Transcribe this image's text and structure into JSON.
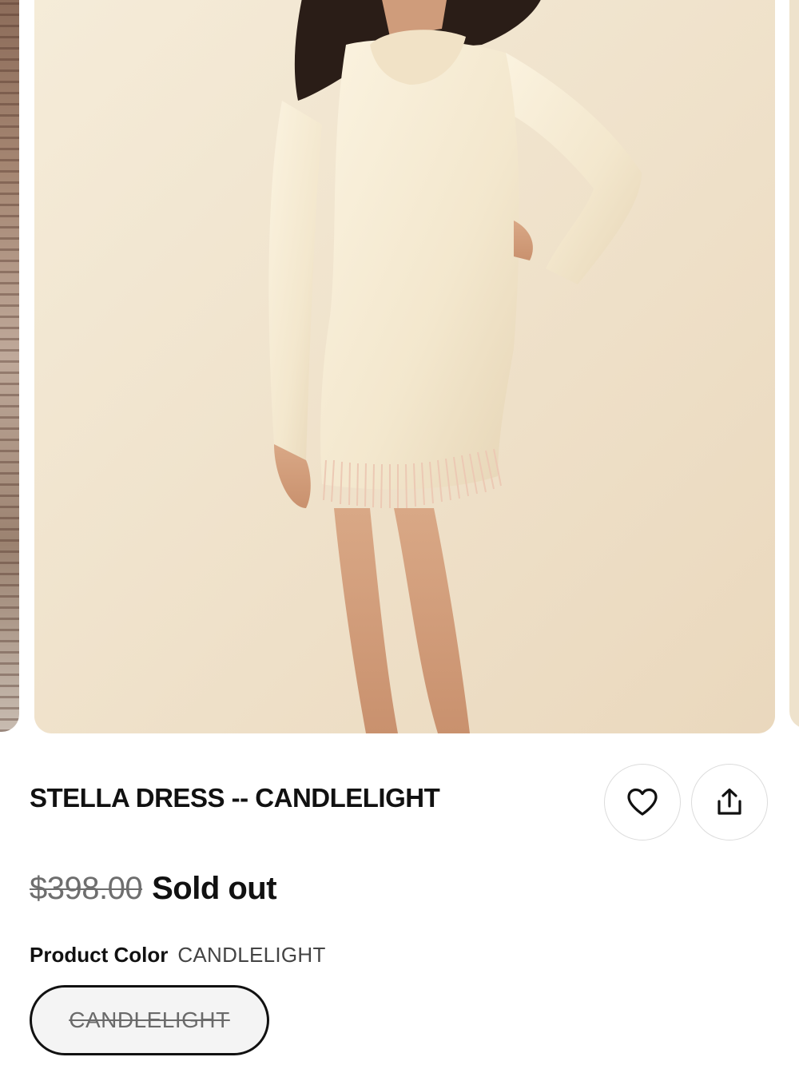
{
  "carousel": {
    "main_image_alt": "Model wearing cream long-sleeve mini dress with fringe hem"
  },
  "product": {
    "title": "STELLA DRESS -- CANDLELIGHT",
    "original_price": "$398.00",
    "status": "Sold out",
    "color_label": "Product Color",
    "color_value": "CANDLELIGHT",
    "swatches": [
      {
        "label": "CANDLELIGHT",
        "available": false,
        "selected": true
      }
    ]
  },
  "actions": {
    "wishlist_icon": "heart-icon",
    "share_icon": "share-icon"
  },
  "colors": {
    "text": "#111111",
    "muted": "#6e6e6e",
    "border": "#dcdcdc",
    "swatch_bg": "#f4f4f4"
  }
}
